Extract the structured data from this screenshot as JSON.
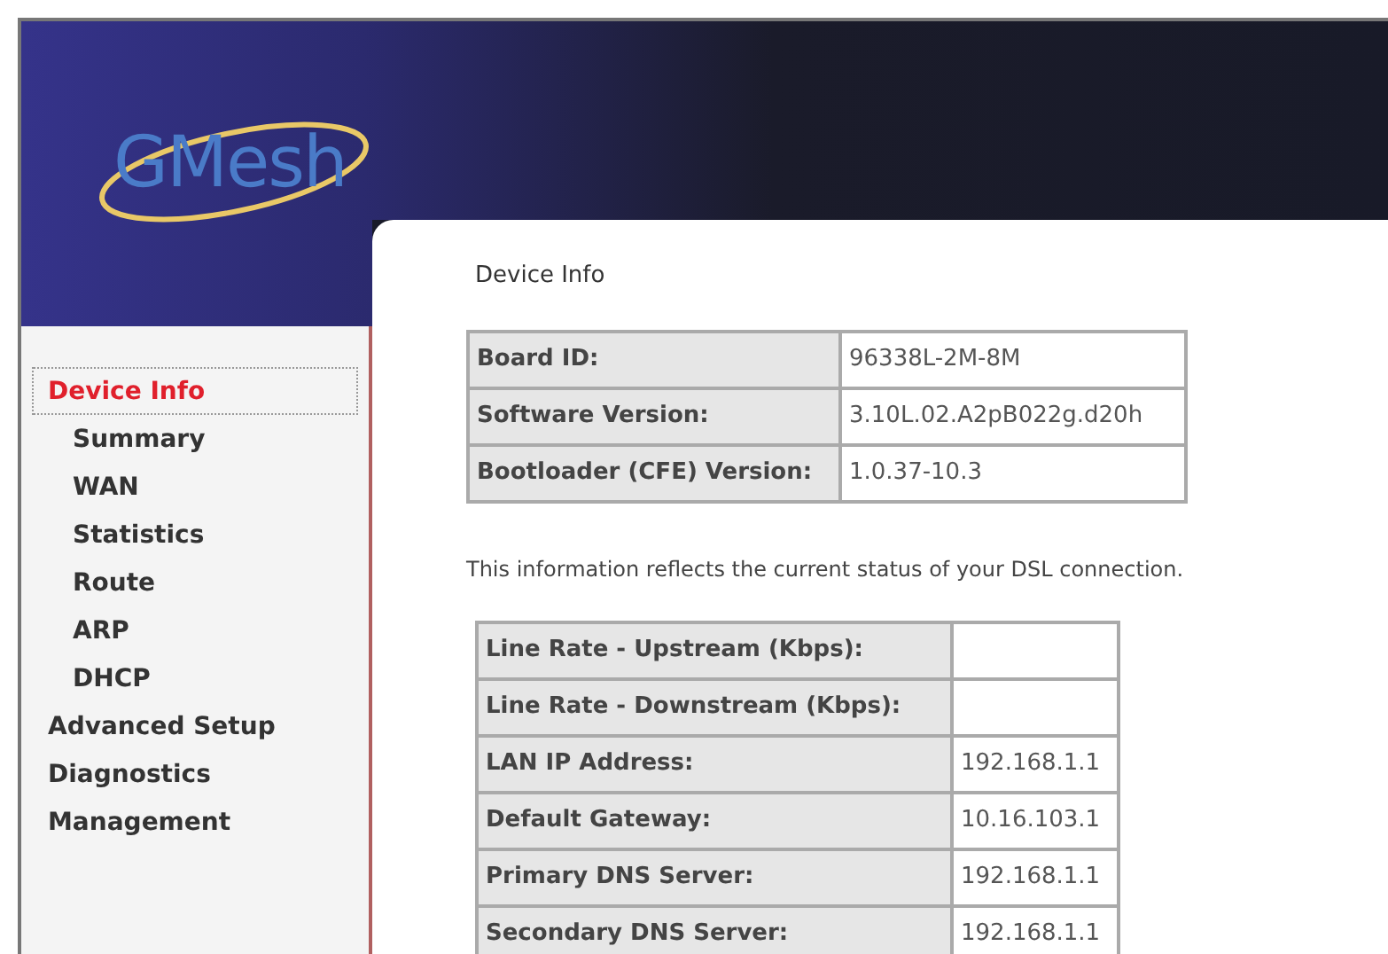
{
  "logo": {
    "text": "GMesh"
  },
  "sidebar": {
    "items": [
      {
        "label": "Device Info",
        "selected": true,
        "children": [
          {
            "label": "Summary",
            "selected": false
          },
          {
            "label": "WAN",
            "selected": false
          },
          {
            "label": "Statistics",
            "selected": false
          },
          {
            "label": "Route",
            "selected": false
          },
          {
            "label": "ARP",
            "selected": false
          },
          {
            "label": "DHCP",
            "selected": false
          }
        ]
      },
      {
        "label": "Advanced Setup",
        "selected": false
      },
      {
        "label": "Diagnostics",
        "selected": false
      },
      {
        "label": "Management",
        "selected": false
      }
    ]
  },
  "page_title": "Device Info",
  "device_table": {
    "rows": [
      {
        "label": "Board ID:",
        "value": "96338L-2M-8M"
      },
      {
        "label": "Software Version:",
        "value": "3.10L.02.A2pB022g.d20h"
      },
      {
        "label": "Bootloader (CFE) Version:",
        "value": "1.0.37-10.3"
      }
    ]
  },
  "status_text": "This information reflects the current status of your DSL connection.",
  "status_table": {
    "rows": [
      {
        "label": "Line Rate - Upstream (Kbps):"
      },
      {
        "label": "Line Rate - Downstream (Kbps):"
      },
      {
        "label": "LAN IP Address:",
        "value": "192.168.1.1"
      },
      {
        "label": "Default Gateway:",
        "value": "10.16.103.1"
      },
      {
        "label": "Primary DNS Server:",
        "value": "192.168.1.1"
      },
      {
        "label": "Secondary DNS Server:",
        "value": "192.168.1.1"
      }
    ]
  }
}
